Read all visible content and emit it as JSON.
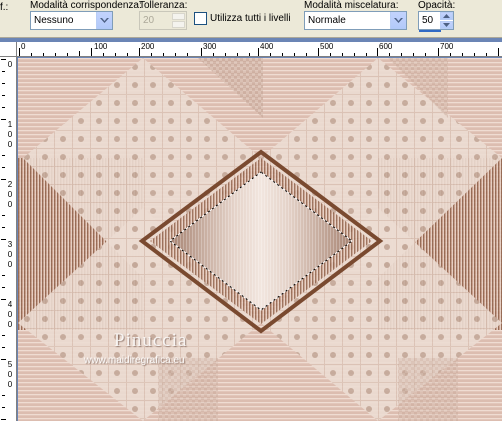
{
  "toolbar": {
    "cut_label": "f.:",
    "match_mode": {
      "label": "Modalità corrispondenza:",
      "value": "Nessuno"
    },
    "tolerance": {
      "label": "Tolleranza:",
      "value": "20"
    },
    "use_all_layers": {
      "label": "Utilizza tutti i livelli",
      "checked": false
    },
    "blend_mode": {
      "label": "Modalità miscelatura:",
      "value": "Normale"
    },
    "opacity": {
      "label": "Opacità:",
      "value": "50"
    }
  },
  "rulers": {
    "horizontal": [
      "0",
      "100",
      "200",
      "300",
      "400",
      "500",
      "600",
      "700"
    ],
    "vertical": [
      "0",
      "100",
      "200",
      "300",
      "400",
      "500"
    ]
  },
  "watermark": {
    "title": "Pinuccia",
    "url": "www.maidiregrafica.eu"
  },
  "colors": {
    "toolbar_bg": "#ece9d8",
    "workspace_bg": "#6b85b5",
    "image_bg": "#d9b9ab",
    "brown": "#7a4a30",
    "light_panel": "#ead8cc"
  }
}
